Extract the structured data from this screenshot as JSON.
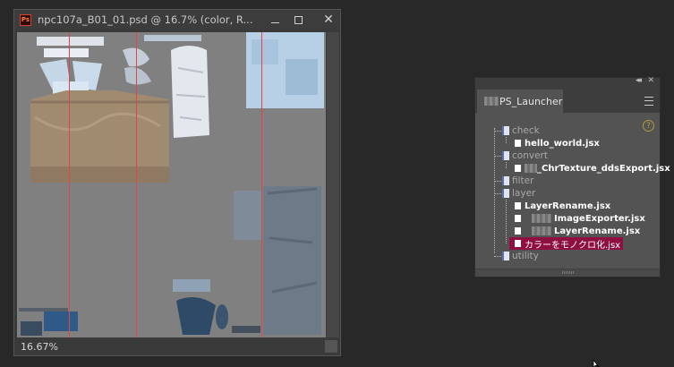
{
  "document": {
    "title": "npc107a_B01_01.psd @ 16.7% (color, R...",
    "app_icon_text": "Ps",
    "zoom": "16.67%"
  },
  "panel": {
    "tab_label": "PS_Launcher",
    "help_glyph": "?",
    "collapse_glyph": "◂◂",
    "close_glyph": "✕",
    "tree": [
      {
        "type": "folder",
        "label": "check",
        "depth": 0
      },
      {
        "type": "file",
        "label": "hello_world.jsx",
        "depth": 1
      },
      {
        "type": "folder",
        "label": "convert",
        "depth": 0
      },
      {
        "type": "file",
        "label": "_ChrTexture_ddsExport.jsx",
        "depth": 1,
        "redacted_prefix": true
      },
      {
        "type": "folder",
        "label": "filter",
        "depth": 0
      },
      {
        "type": "folder",
        "label": "layer",
        "depth": 0
      },
      {
        "type": "file",
        "label": "LayerRename.jsx",
        "depth": 1
      },
      {
        "type": "file",
        "label": "ImageExporter.jsx",
        "depth": 1,
        "redacted_prefix": true
      },
      {
        "type": "file",
        "label": "LayerRename.jsx",
        "depth": 1,
        "redacted_prefix": true
      },
      {
        "type": "file",
        "label": "カラーをモノクロ化.jsx",
        "depth": 1,
        "selected": true
      },
      {
        "type": "folder",
        "label": "utility",
        "depth": 0
      }
    ]
  },
  "colors": {
    "workspace_bg": "#282828",
    "canvas_gray": "#808080",
    "guide_red": "#e0454a",
    "selection": "#8f1040",
    "folder_blue": "#5872b8"
  }
}
